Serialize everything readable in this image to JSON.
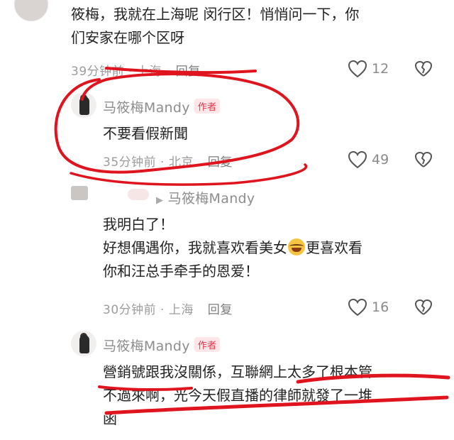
{
  "comments": [
    {
      "text_line1": "筱梅，我就在上海呢 闵行区！悄悄问一下，你",
      "text_line2": "们安家在哪个区呀",
      "time": "39分钟前",
      "location": "上海",
      "reply": "回复",
      "likes": "12"
    },
    {
      "author": "马筱梅Mandy",
      "badge": "作者",
      "text": "不要看假新聞",
      "time": "35分钟前",
      "location": "北京",
      "reply": "回复",
      "likes": "49"
    },
    {
      "reply_to": "马筱梅Mandy",
      "line1": "我明白了！",
      "line2a": "好想偶遇你，我就喜欢看美女",
      "line2b": "更喜欢看",
      "line3": "你和汪总手牵手的恩爱！",
      "time": "30分钟前",
      "location": "上海",
      "reply": "回复",
      "likes": "16"
    },
    {
      "author": "马筱梅Mandy",
      "badge": "作者",
      "line1": "營銷號跟我沒關係，互聯網上太多了根本管",
      "line2": "不過來啊，光今天假直播的律師就發了一堆",
      "line3": "函"
    }
  ],
  "colors": {
    "annotation_red": "#e0141e",
    "badge_red": "#e0384b",
    "meta_gray": "#9c9c9c"
  },
  "icons": [
    "heart-outline-icon",
    "broken-heart-icon",
    "reply-arrow-icon",
    "laughing-emoji-icon"
  ]
}
